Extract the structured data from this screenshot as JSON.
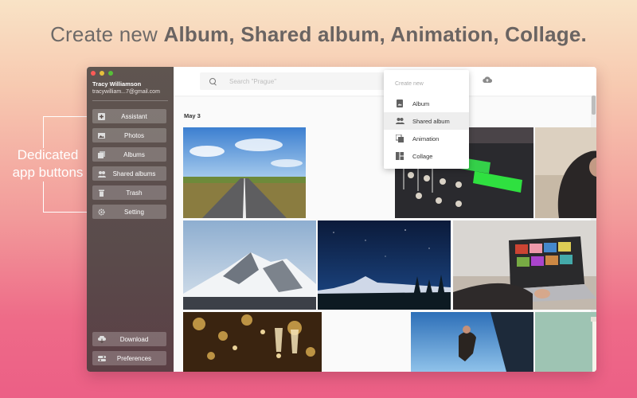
{
  "headline": {
    "prefix": "Create new ",
    "items": "Album, Shared album, Animation, Collage."
  },
  "callout": {
    "line1": "Dedicated",
    "line2": "app buttons"
  },
  "window": {
    "traffic_colors": [
      "#fc5b57",
      "#e5bf3c",
      "#57c038"
    ],
    "user": {
      "name": "Tracy Williamson",
      "email": "tracywilliam...7@gmail.com"
    },
    "sidebar": {
      "items": [
        {
          "label": "Assistant",
          "icon": "assistant-icon"
        },
        {
          "label": "Photos",
          "icon": "photos-icon"
        },
        {
          "label": "Albums",
          "icon": "albums-icon"
        },
        {
          "label": "Shared albums",
          "icon": "shared-albums-icon"
        },
        {
          "label": "Trash",
          "icon": "trash-icon"
        },
        {
          "label": "Setting",
          "icon": "gear-icon"
        }
      ],
      "bottom": [
        {
          "label": "Download",
          "icon": "download-icon"
        },
        {
          "label": "Preferences",
          "icon": "preferences-icon"
        }
      ]
    },
    "search": {
      "placeholder": "Search \"Prague\""
    },
    "date_label": "May 3",
    "menu": {
      "title": "Create new",
      "items": [
        {
          "label": "Album",
          "icon": "album-icon"
        },
        {
          "label": "Shared album",
          "icon": "shared-album-icon",
          "active": true
        },
        {
          "label": "Animation",
          "icon": "animation-icon"
        },
        {
          "label": "Collage",
          "icon": "collage-icon"
        }
      ]
    }
  }
}
